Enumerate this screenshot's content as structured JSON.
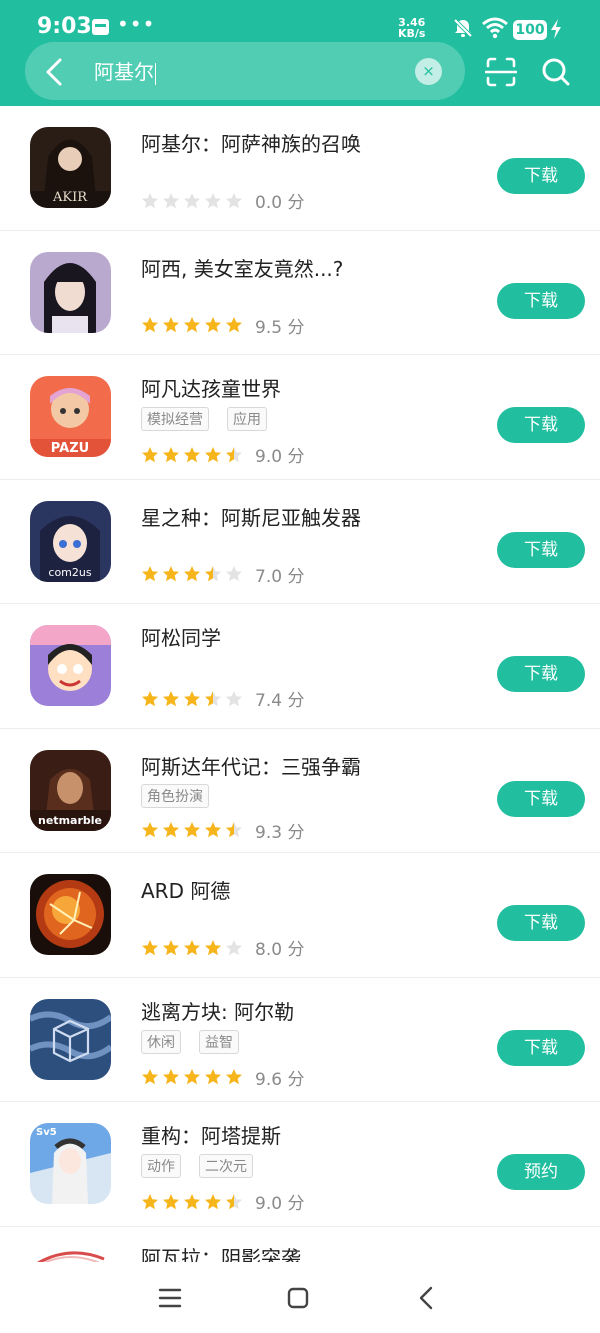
{
  "status_bar": {
    "time": "9:03",
    "dots": "•••",
    "net_speed_value": "3.46",
    "net_speed_unit": "KB/s",
    "battery": "100"
  },
  "search": {
    "query": "阿基尔",
    "clear_icon": "×"
  },
  "apps": [
    {
      "title": "阿基尔：阿萨神族的召唤",
      "tags": [],
      "stars": 0,
      "score": "0.0 分",
      "button": "下载"
    },
    {
      "title": "阿西, 美女室友竟然...?",
      "tags": [],
      "stars": 5,
      "score": "9.5 分",
      "button": "下载"
    },
    {
      "title": "阿凡达孩童世界",
      "tags": [
        "模拟经营",
        "应用"
      ],
      "stars": 4.5,
      "score": "9.0 分",
      "button": "下载"
    },
    {
      "title": "星之种：阿斯尼亚触发器",
      "tags": [],
      "stars": 3.5,
      "score": "7.0 分",
      "button": "下载"
    },
    {
      "title": "阿松同学",
      "tags": [],
      "stars": 3.5,
      "score": "7.4 分",
      "button": "下载"
    },
    {
      "title": "阿斯达年代记：三强争霸",
      "tags": [
        "角色扮演"
      ],
      "stars": 4.5,
      "score": "9.3 分",
      "button": "下载"
    },
    {
      "title": "ARD 阿德",
      "tags": [],
      "stars": 4,
      "score": "8.0 分",
      "button": "下载"
    },
    {
      "title": "逃离方块: 阿尔勒",
      "tags": [
        "休闲",
        "益智"
      ],
      "stars": 5,
      "score": "9.6 分",
      "button": "下载"
    },
    {
      "title": "重构：阿塔提斯",
      "tags": [
        "动作",
        "二次元"
      ],
      "stars": 4.5,
      "score": "9.0 分",
      "button": "预约"
    }
  ],
  "partial_app": {
    "title": "阿瓦拉：阴影突袭"
  },
  "colors": {
    "accent": "#21bf9f",
    "star": "#f7b51c",
    "star_empty": "#e3e3e3"
  },
  "icons": {
    "back": "back-arrow-icon",
    "scan": "scan-icon",
    "search": "search-icon",
    "nav_menu": "menu-icon",
    "nav_home": "home-icon",
    "nav_back": "nav-back-icon"
  }
}
